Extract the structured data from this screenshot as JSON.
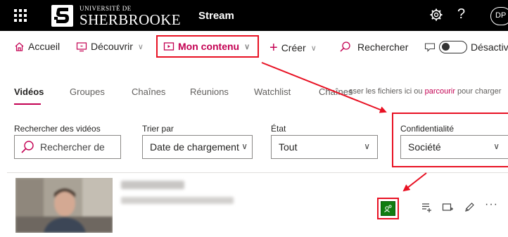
{
  "topbar": {
    "logo_small": "UNIVERSITÉ DE",
    "logo_big": "SHERBROOKE",
    "app_title": "Stream",
    "help_glyph": "?",
    "avatar_initials": "DP"
  },
  "nav": {
    "home": "Accueil",
    "discover": "Découvrir",
    "my_content": "Mon contenu",
    "create": "Créer",
    "search": "Rechercher",
    "toggle_label": "Désactiv"
  },
  "tabs": [
    "Vidéos",
    "Groupes",
    "Chaînes",
    "Réunions",
    "Watchlist",
    "Chaînes"
  ],
  "upload_hint": {
    "before": "sser les fichiers ici ou ",
    "link": "parcourir",
    "after": " pour charger"
  },
  "filters": {
    "search_label": "Rechercher des vidéos",
    "search_placeholder": "Rechercher de",
    "sort_label": "Trier par",
    "sort_value": "Date de chargement",
    "state_label": "État",
    "state_value": "Tout",
    "privacy_label": "Confidentialité",
    "privacy_value": "Société"
  },
  "video_row": {
    "more_label": "···"
  },
  "icons": {
    "waffle": "waffle-icon",
    "gear": "gear-icon",
    "home": "home-icon",
    "discover": "discover-icon",
    "my_content": "video-icon",
    "create": "plus-icon",
    "search": "search-icon",
    "comment": "comment-icon",
    "privacy": "company-privacy-icon",
    "captions": "captions-icon",
    "share": "share-icon",
    "edit": "pencil-icon"
  },
  "colors": {
    "accent": "#c30052",
    "annotation_red": "#e81123",
    "privacy_green": "#107c10",
    "topbar": "#000000"
  }
}
